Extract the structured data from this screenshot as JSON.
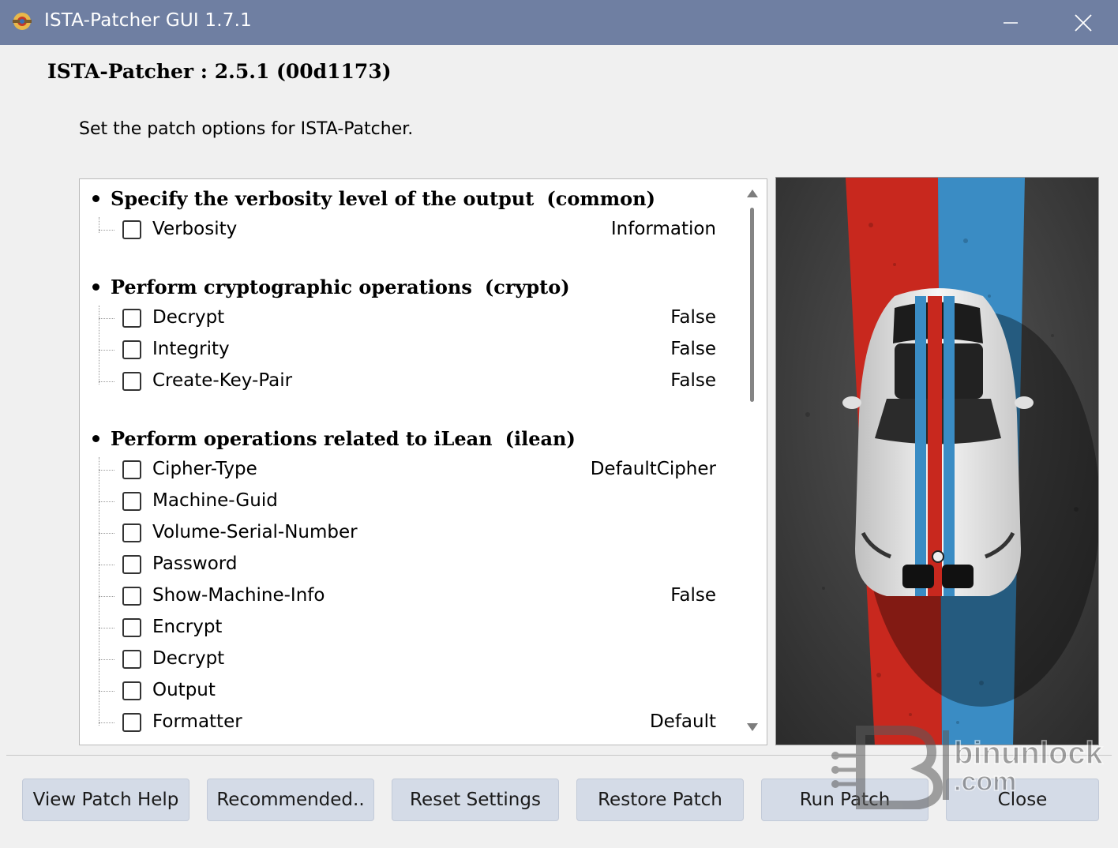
{
  "window": {
    "title": "ISTA-Patcher GUI  1.7.1",
    "minimize_icon": "minimize-icon",
    "close_icon": "close-icon"
  },
  "header": {
    "title": "ISTA-Patcher : 2.5.1 (00d1173)",
    "subtitle": "Set the patch options for ISTA-Patcher."
  },
  "groups": [
    {
      "title": "Specify the verbosity level of the output",
      "tag": "(common)",
      "options": [
        {
          "label": "Verbosity",
          "value": "Information",
          "checked": false
        }
      ]
    },
    {
      "title": "Perform cryptographic operations",
      "tag": "(crypto)",
      "options": [
        {
          "label": "Decrypt",
          "value": "False",
          "checked": false
        },
        {
          "label": "Integrity",
          "value": "False",
          "checked": false
        },
        {
          "label": "Create-Key-Pair",
          "value": "False",
          "checked": false
        }
      ]
    },
    {
      "title": "Perform operations related to iLean",
      "tag": "(ilean)",
      "options": [
        {
          "label": "Cipher-Type",
          "value": "DefaultCipher",
          "checked": false
        },
        {
          "label": "Machine-Guid",
          "value": "",
          "checked": false
        },
        {
          "label": "Volume-Serial-Number",
          "value": "",
          "checked": false
        },
        {
          "label": "Password",
          "value": "",
          "checked": false
        },
        {
          "label": "Show-Machine-Info",
          "value": "False",
          "checked": false
        },
        {
          "label": "Encrypt",
          "value": "",
          "checked": false
        },
        {
          "label": "Decrypt",
          "value": "",
          "checked": false
        },
        {
          "label": "Output",
          "value": "",
          "checked": false
        },
        {
          "label": "Formatter",
          "value": "Default",
          "checked": false
        }
      ]
    }
  ],
  "buttons": {
    "view_help": "View Patch Help",
    "recommended": "Recommended..",
    "reset": "Reset Settings",
    "restore": "Restore Patch",
    "run": "Run Patch",
    "close": "Close"
  },
  "image": {
    "subject": "car-top-view-image",
    "stripe_colors": [
      "#c8281e",
      "#3a8cc4"
    ],
    "ground_color": "#3a3a3a"
  },
  "watermark": {
    "line1": "binunlock",
    "line2": ".com"
  }
}
